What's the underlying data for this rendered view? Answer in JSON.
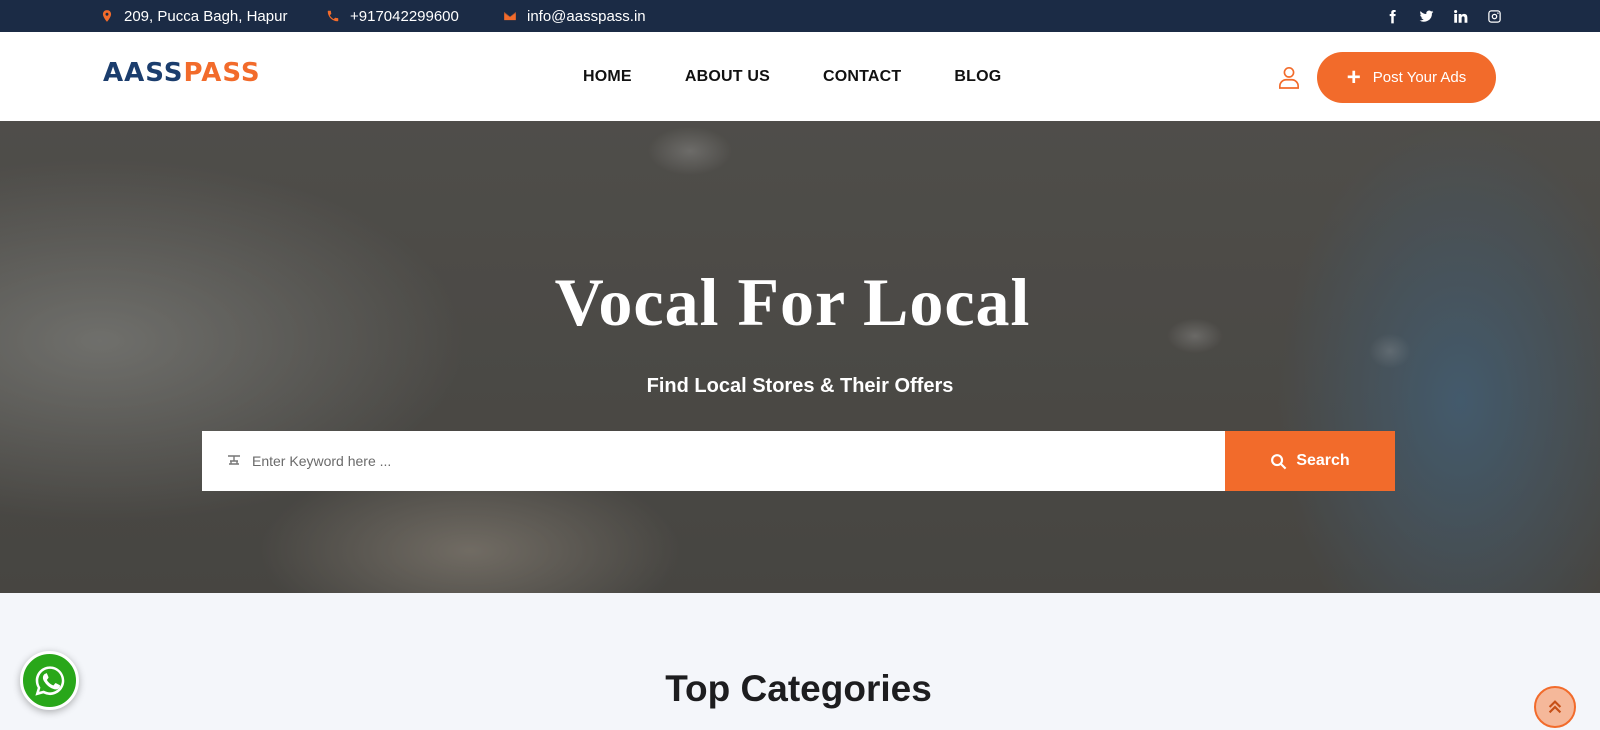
{
  "topbar": {
    "address": "209, Pucca Bagh, Hapur",
    "phone": "+917042299600",
    "email": "info@aasspass.in",
    "icons": {
      "address": "map-pin-icon",
      "phone": "phone-icon",
      "email": "envelope-icon"
    },
    "socials": [
      "facebook-icon",
      "twitter-icon",
      "linkedin-icon",
      "instagram-icon"
    ]
  },
  "header": {
    "logo_part1": "AASS",
    "logo_part2": "PASS",
    "nav": [
      "HOME",
      "ABOUT US",
      "CONTACT",
      "BLOG"
    ],
    "user_icon": "user-icon",
    "post_button": "Post Your Ads"
  },
  "hero": {
    "title": "Vocal For Local",
    "subtitle": "Find Local Stores & Their Offers",
    "search_placeholder": "Enter Keyword here ...",
    "search_button": "Search"
  },
  "section": {
    "title": "Top Categories"
  },
  "colors": {
    "accent": "#f26b2b",
    "topbar": "#1b2b45",
    "logo_blue": "#1b3d6d",
    "whatsapp": "#29a71a"
  }
}
